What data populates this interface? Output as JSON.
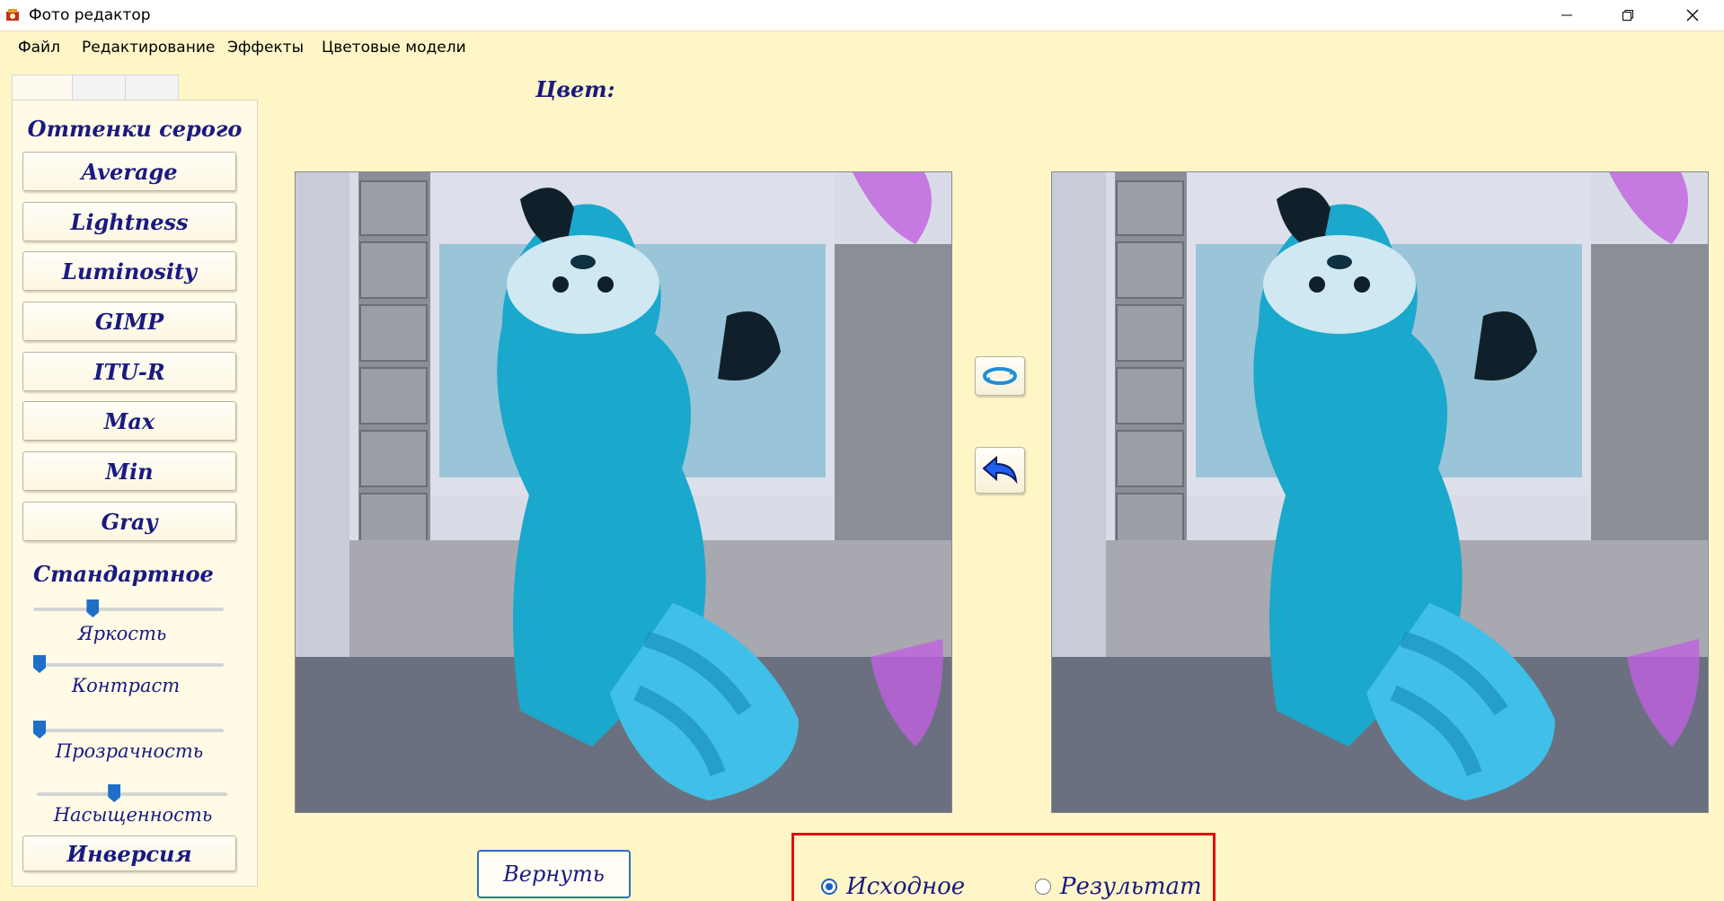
{
  "window": {
    "title": "Фото редактор"
  },
  "menu": [
    "Файл",
    "Редактирование",
    "Эффекты",
    "Цветовые модели"
  ],
  "left_panel": {
    "grayscale_title": "Оттенки серого",
    "grayscale_buttons": [
      "Average",
      "Lightness",
      "Luminosity",
      "GIMP",
      "ITU-R",
      "Max",
      "Min",
      "Gray"
    ],
    "standard_title": "Стандартное",
    "sliders": [
      {
        "label": "Яркость",
        "value": 0.3
      },
      {
        "label": "Контраст",
        "value": 0.0
      },
      {
        "label": "Прозрачность",
        "value": 0.0
      },
      {
        "label": "Насыщенность",
        "value": 0.4
      }
    ],
    "inversion_button": "Инверсия"
  },
  "color_label": "Цвет:",
  "images": {
    "left": "red panda (color-inverted, blue)",
    "right": "red panda (color-inverted, blue)"
  },
  "side_buttons": {
    "rotate_icon": "rotate-arrows-icon",
    "undo_icon": "back-arrow-icon"
  },
  "restore_button": "Вернуть",
  "radio": {
    "options": [
      "Исходное",
      "Результат"
    ],
    "selected": "Исходное"
  },
  "colors": {
    "background": "#fff6c8",
    "accent": "#1a5fbf",
    "text": "#1a1a80",
    "highlight": "#e01010"
  }
}
